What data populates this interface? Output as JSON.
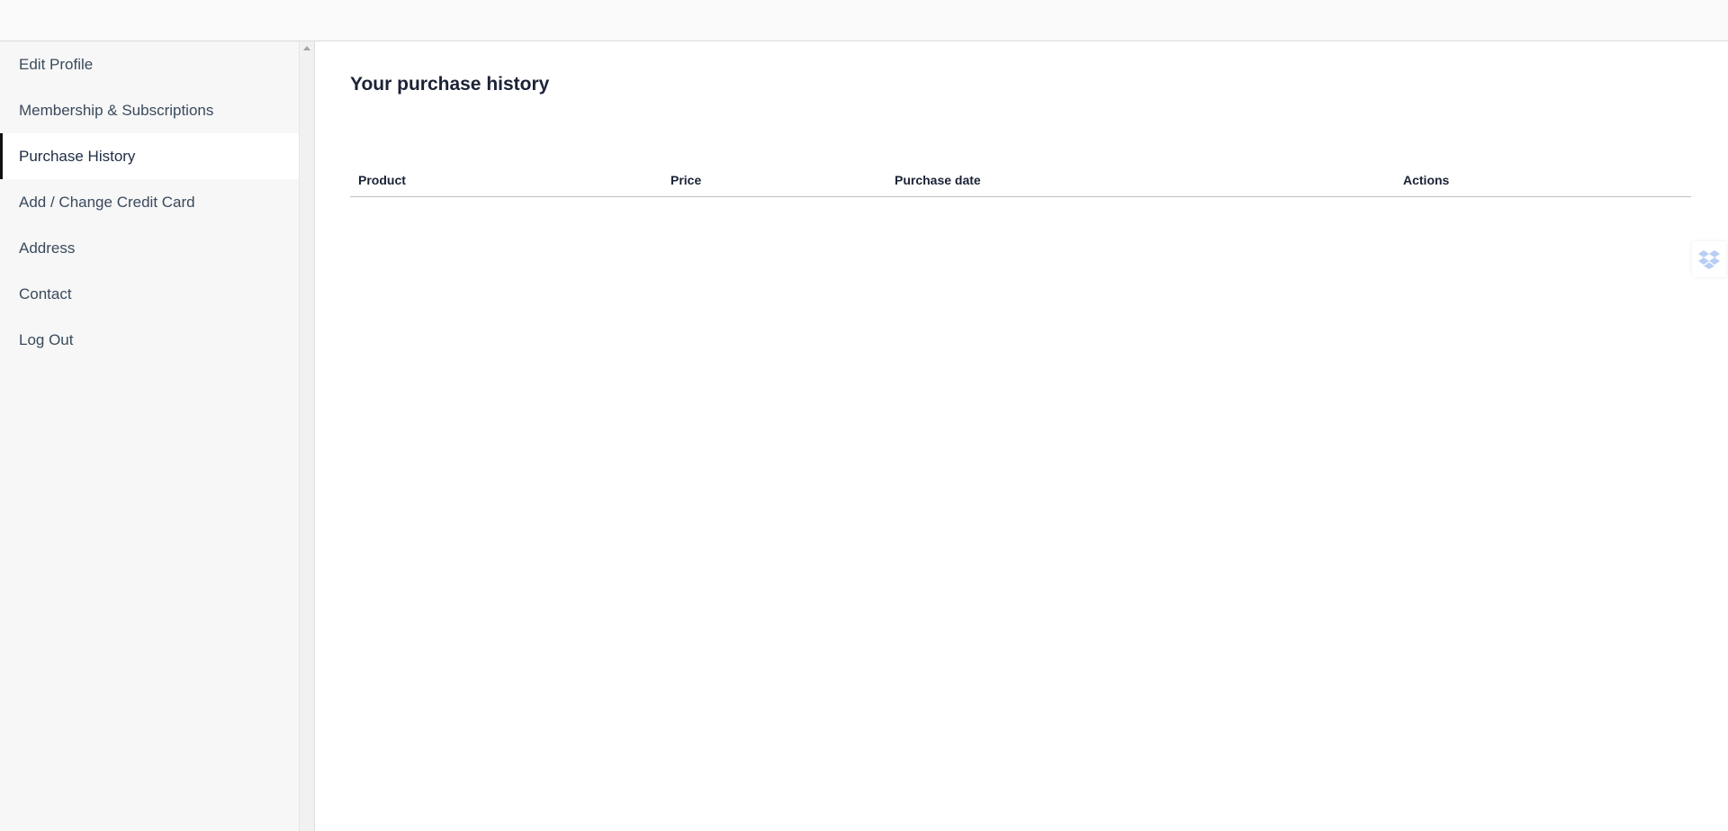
{
  "sidebar": {
    "items": [
      {
        "label": "Edit Profile"
      },
      {
        "label": "Membership & Subscriptions"
      },
      {
        "label": "Purchase History"
      },
      {
        "label": "Add / Change Credit Card"
      },
      {
        "label": "Address"
      },
      {
        "label": "Contact"
      },
      {
        "label": "Log Out"
      }
    ],
    "active_index": 2
  },
  "main": {
    "title": "Your purchase history",
    "table": {
      "columns": [
        "Product",
        "Price",
        "Purchase date",
        "Actions"
      ],
      "rows": []
    }
  },
  "widgets": {
    "floating": {
      "icon": "dropbox-icon"
    }
  },
  "colors": {
    "active_indicator": "#111111",
    "nav_text": "#3a4a5c",
    "heading_text": "#1a2236",
    "dropbox_blue": "#b9cdf5"
  }
}
